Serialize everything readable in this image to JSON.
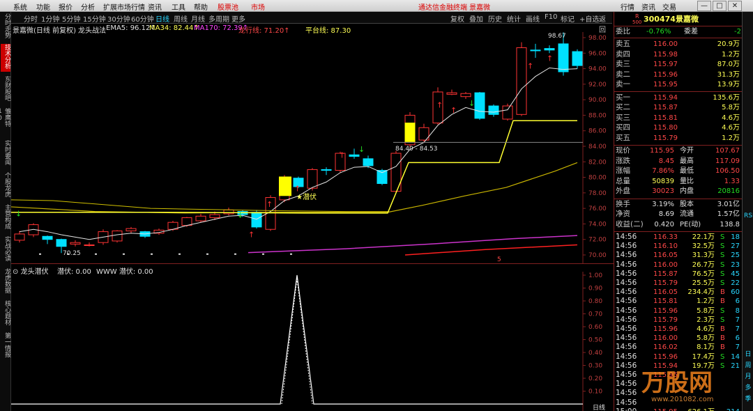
{
  "menu": {
    "items": [
      "系统",
      "功能",
      "报价",
      "分析",
      "扩展市场行情",
      "资讯",
      "工具",
      "帮助"
    ],
    "stock_pool": "股票池",
    "market": "市场",
    "notice": "通达信金融终端  景嘉微",
    "right_buttons": [
      "行情",
      "资讯",
      "交易"
    ]
  },
  "toolbar": {
    "periods": [
      "分时",
      "1分钟",
      "5分钟",
      "15分钟",
      "30分钟",
      "60分钟",
      "日线",
      "周线",
      "月线",
      "多周期",
      "更多"
    ],
    "selected": "日线",
    "tools": [
      "复权",
      "叠加",
      "历史",
      "统计",
      "画线",
      "F10",
      "标记",
      "+自选",
      "返回"
    ]
  },
  "leftbar": [
    "分时走势",
    "技术分析",
    "东财股吧",
    "雏鹰特10",
    "实时要闻",
    "个股龙虎",
    "主营构成",
    "实战必读",
    "龙虎数据",
    "核心题材",
    "第一情报"
  ],
  "chart_header": {
    "title": "景嘉微(日线 前复权)",
    "indicator": "龙头战法",
    "ema5": "EMA5: 96.12↑",
    "ma34": "MA34: 82.44↑",
    "ma170": "MA170: 72.39↑",
    "dragon": "龙行线: 71.20↑",
    "platform": "平台线: 87.30"
  },
  "main_axis_labels": [
    "98.00",
    "96.00",
    "94.00",
    "92.00",
    "90.00",
    "88.00",
    "86.00",
    "84.00",
    "82.00",
    "80.00",
    "78.00",
    "76.00",
    "74.00",
    "72.00",
    "70.00"
  ],
  "annotations": {
    "high": "98.67",
    "low": "70.25",
    "range": "84.40 - 84.53",
    "latent": "潜伏",
    "five": "5"
  },
  "sub_header": {
    "name": "龙头潜伏",
    "v1": "潜伏: 0.00",
    "v2": "WWW 潜伏: 0.00"
  },
  "sub_axis_labels": [
    "1.00",
    "0.90",
    "0.80",
    "0.70",
    "0.60",
    "0.50",
    "0.40",
    "0.30",
    "0.20",
    "0.10"
  ],
  "sub_bottom": "日线",
  "quote": {
    "code": "300474",
    "name": "景嘉微",
    "r_label": "R",
    "board": "500",
    "weibi_label": "委比",
    "weibi": "-0.76%",
    "weicha_label": "委差",
    "weicha": "-2",
    "asks": [
      {
        "label": "卖五",
        "price": "116.00",
        "vol": "20.9万"
      },
      {
        "label": "卖四",
        "price": "115.98",
        "vol": "1.2万"
      },
      {
        "label": "卖三",
        "price": "115.97",
        "vol": "87.0万"
      },
      {
        "label": "卖二",
        "price": "115.96",
        "vol": "31.3万"
      },
      {
        "label": "卖一",
        "price": "115.95",
        "vol": "13.9万"
      }
    ],
    "bids": [
      {
        "label": "买一",
        "price": "115.94",
        "vol": "135.6万"
      },
      {
        "label": "买二",
        "price": "115.87",
        "vol": "5.8万"
      },
      {
        "label": "买三",
        "price": "115.81",
        "vol": "4.6万"
      },
      {
        "label": "买四",
        "price": "115.80",
        "vol": "4.6万"
      },
      {
        "label": "买五",
        "price": "115.79",
        "vol": "1.2万"
      }
    ],
    "stats": [
      {
        "l1": "现价",
        "v1": "115.95",
        "l2": "今开",
        "v2": "107.67",
        "c1": "r",
        "c2": "r"
      },
      {
        "l1": "涨跌",
        "v1": "8.45",
        "l2": "最高",
        "v2": "117.09",
        "c1": "r",
        "c2": "r"
      },
      {
        "l1": "涨幅",
        "v1": "7.86%",
        "l2": "最低",
        "v2": "106.50",
        "c1": "r",
        "c2": "r"
      },
      {
        "l1": "总量",
        "v1": "50839",
        "l2": "量比",
        "v2": "1.33",
        "c1": "y",
        "c2": "r"
      },
      {
        "l1": "外盘",
        "v1": "30023",
        "l2": "内盘",
        "v2": "20816",
        "c1": "r",
        "c2": "g"
      }
    ],
    "stats2": [
      {
        "l1": "换手",
        "v1": "3.19%",
        "l2": "股本",
        "v2": "3.01亿",
        "c1": "w",
        "c2": "w"
      },
      {
        "l1": "净资",
        "v1": "8.69",
        "l2": "流通",
        "v2": "1.57亿",
        "c1": "w",
        "c2": "w"
      },
      {
        "l1": "收益(二)",
        "v1": "0.420",
        "l2": "PE(动)",
        "v2": "138.8",
        "c1": "w",
        "c2": "w"
      }
    ],
    "ticks": [
      {
        "t": "14:56",
        "p": "116.33",
        "v": "22.1万",
        "d": "S",
        "n": "18"
      },
      {
        "t": "14:56",
        "p": "116.10",
        "v": "32.5万",
        "d": "S",
        "n": "27"
      },
      {
        "t": "14:56",
        "p": "116.05",
        "v": "31.3万",
        "d": "S",
        "n": "25"
      },
      {
        "t": "14:56",
        "p": "116.00",
        "v": "26.7万",
        "d": "S",
        "n": "23"
      },
      {
        "t": "14:56",
        "p": "115.87",
        "v": "76.5万",
        "d": "S",
        "n": "45"
      },
      {
        "t": "14:56",
        "p": "115.79",
        "v": "25.5万",
        "d": "S",
        "n": "22"
      },
      {
        "t": "14:56",
        "p": "116.05",
        "v": "234.4万",
        "d": "B",
        "n": "60"
      },
      {
        "t": "14:56",
        "p": "115.81",
        "v": "1.2万",
        "d": "B",
        "n": "6"
      },
      {
        "t": "14:56",
        "p": "115.96",
        "v": "5.8万",
        "d": "S",
        "n": "8"
      },
      {
        "t": "14:56",
        "p": "115.79",
        "v": "2.3万",
        "d": "S",
        "n": "7"
      },
      {
        "t": "14:56",
        "p": "115.96",
        "v": "4.6万",
        "d": "B",
        "n": "7"
      },
      {
        "t": "14:56",
        "p": "116.00",
        "v": "5.8万",
        "d": "B",
        "n": "6"
      },
      {
        "t": "14:56",
        "p": "116.02",
        "v": "8.1万",
        "d": "B",
        "n": "7"
      },
      {
        "t": "14:56",
        "p": "115.96",
        "v": "17.4万",
        "d": "S",
        "n": "14"
      },
      {
        "t": "14:56",
        "p": "115.94",
        "v": "19.7万",
        "d": "S",
        "n": "21"
      },
      {
        "t": "14:56",
        "p": "115.95",
        "v": "",
        "d": "",
        "n": ""
      },
      {
        "t": "14:56",
        "p": "",
        "v": "",
        "d": "",
        "n": ""
      },
      {
        "t": "14:56",
        "p": "",
        "v": "",
        "d": "",
        "n": ""
      },
      {
        "t": "14:56",
        "p": "",
        "v": "",
        "d": "",
        "n": ""
      },
      {
        "t": "15:00",
        "p": "115.95",
        "v": "626.1万",
        "d": "",
        "n": "214"
      }
    ]
  },
  "scrollbar": [
    "RSI",
    "日",
    "周",
    "月",
    "多",
    "季"
  ],
  "watermark": {
    "text": "万股网",
    "url": "www.201082.com"
  },
  "colors": {
    "red": "#ff4848",
    "green": "#22dd22",
    "cyan": "#29d7ff",
    "yellow": "#ffff55",
    "frame": "#802020"
  }
}
